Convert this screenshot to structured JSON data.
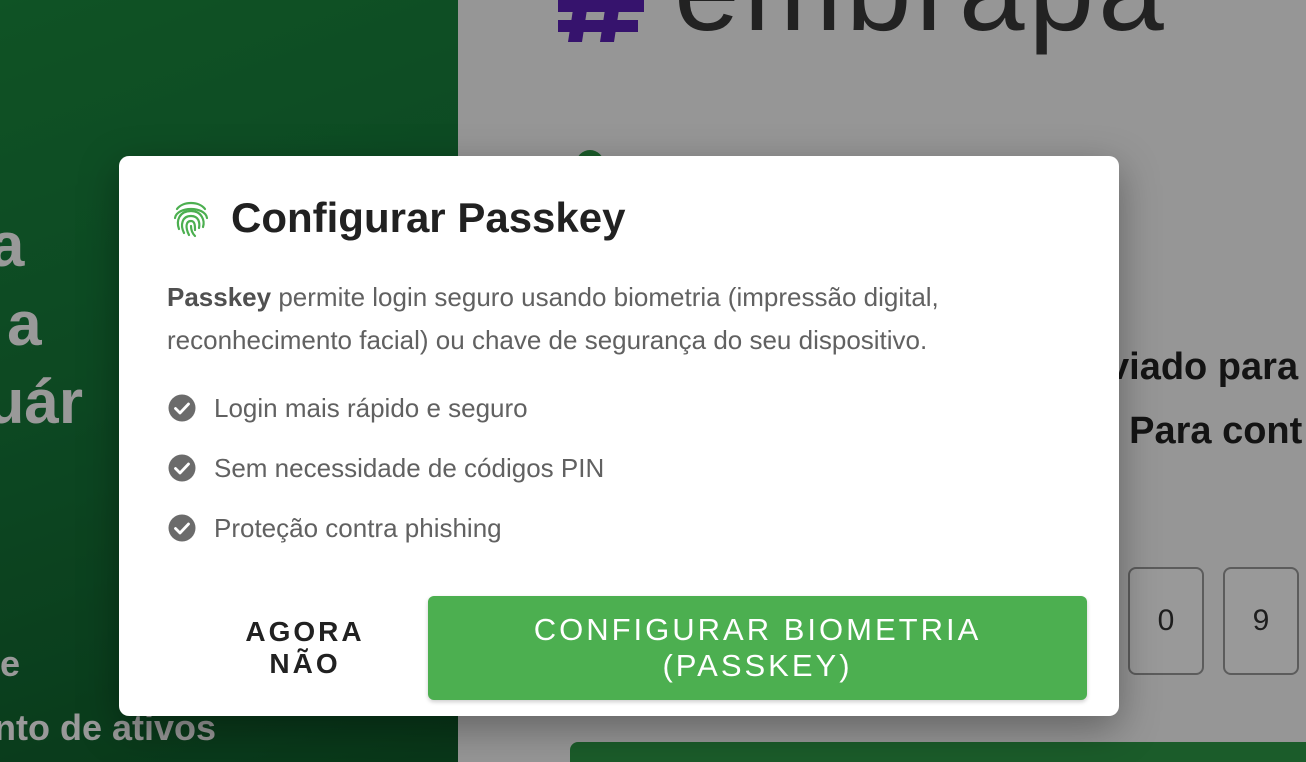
{
  "background": {
    "hero_lines": [
      "ua",
      "o a",
      "cuár"
    ],
    "hero_sub_lines": [
      "de",
      "nento de ativos"
    ],
    "logo_text": "embrapa",
    "code_digits": [
      "0",
      "9"
    ],
    "page_text_lines": [
      "viado para",
      ". Para cont"
    ]
  },
  "dialog": {
    "title": "Configurar Passkey",
    "title_icon": "fingerprint-icon",
    "description_strong": "Passkey",
    "description_rest": " permite login seguro usando biometria (impressão digital, reconhecimento facial) ou chave de segurança do seu dispositivo.",
    "benefits": [
      "Login mais rápido e seguro",
      "Sem necessidade de códigos PIN",
      "Proteção contra phishing"
    ],
    "benefit_icon": "check-circle-icon",
    "secondary_button": "AGORA NÃO",
    "primary_button": "CONFIGURAR BIOMETRIA (PASSKEY)"
  },
  "colors": {
    "primary": "#4caf50",
    "brand_green": "#16793a",
    "logo_purple": "#5b21b6"
  }
}
